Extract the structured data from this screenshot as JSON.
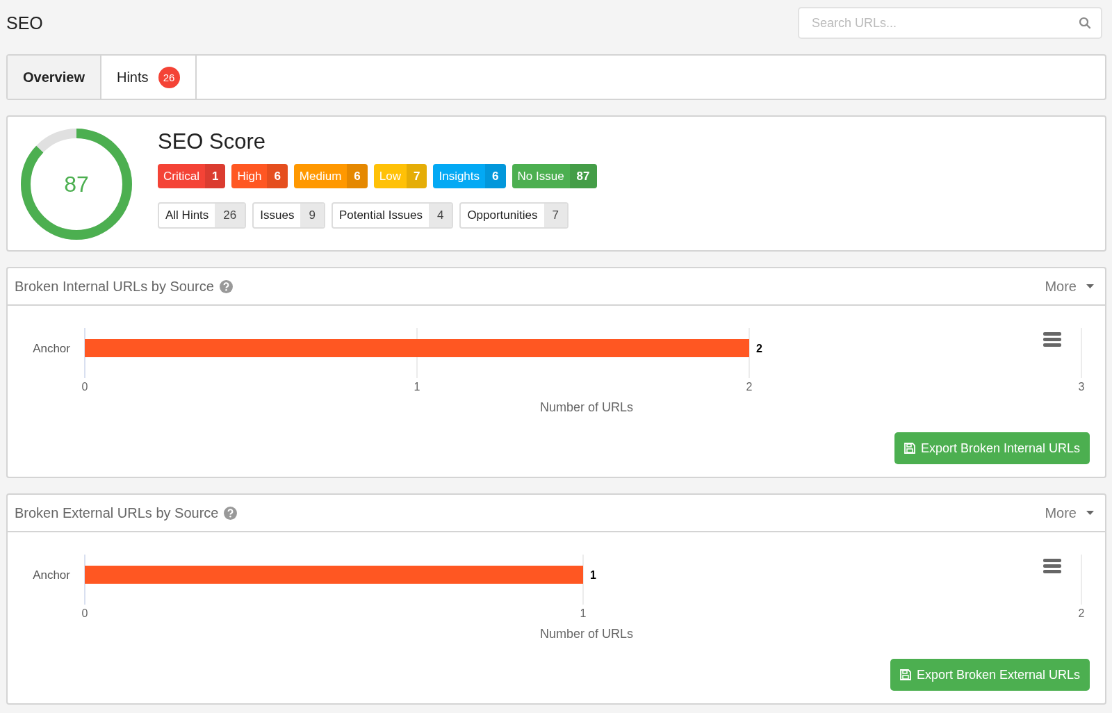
{
  "page_title": "SEO",
  "search": {
    "placeholder": "Search URLs..."
  },
  "tabs": [
    {
      "label": "Overview",
      "selected": true
    },
    {
      "label": "Hints",
      "selected": false,
      "badge": "26"
    }
  ],
  "score": {
    "title": "SEO Score",
    "value": "87",
    "level": 0.87,
    "severities": [
      {
        "label": "Critical",
        "count": "1",
        "color": "#f44336"
      },
      {
        "label": "High",
        "count": "6",
        "color": "#ff5722"
      },
      {
        "label": "Medium",
        "count": "6",
        "color": "#ff9800"
      },
      {
        "label": "Low",
        "count": "7",
        "color": "#ffc107"
      },
      {
        "label": "Insights",
        "count": "6",
        "color": "#03a9f4"
      },
      {
        "label": "No Issue",
        "count": "87",
        "color": "#4caf50"
      }
    ],
    "filters": [
      {
        "label": "All Hints",
        "count": "26"
      },
      {
        "label": "Issues",
        "count": "9"
      },
      {
        "label": "Potential Issues",
        "count": "4"
      },
      {
        "label": "Opportunities",
        "count": "7"
      }
    ]
  },
  "panels": [
    {
      "title": "Broken Internal URLs by Source",
      "more": "More",
      "export": "Export Broken Internal URLs",
      "chart_data": {
        "type": "bar",
        "orientation": "horizontal",
        "xlabel": "Number of URLs",
        "categories": [
          "Anchor"
        ],
        "values": [
          2
        ],
        "xlim": [
          0,
          3
        ],
        "xticks": [
          0,
          1,
          2,
          3
        ],
        "data_labels": true
      }
    },
    {
      "title": "Broken External URLs by Source",
      "more": "More",
      "export": "Export Broken External URLs",
      "chart_data": {
        "type": "bar",
        "orientation": "horizontal",
        "xlabel": "Number of URLs",
        "categories": [
          "Anchor"
        ],
        "values": [
          1
        ],
        "xlim": [
          0,
          2
        ],
        "xticks": [
          0,
          1,
          2
        ],
        "data_labels": true
      }
    }
  ]
}
